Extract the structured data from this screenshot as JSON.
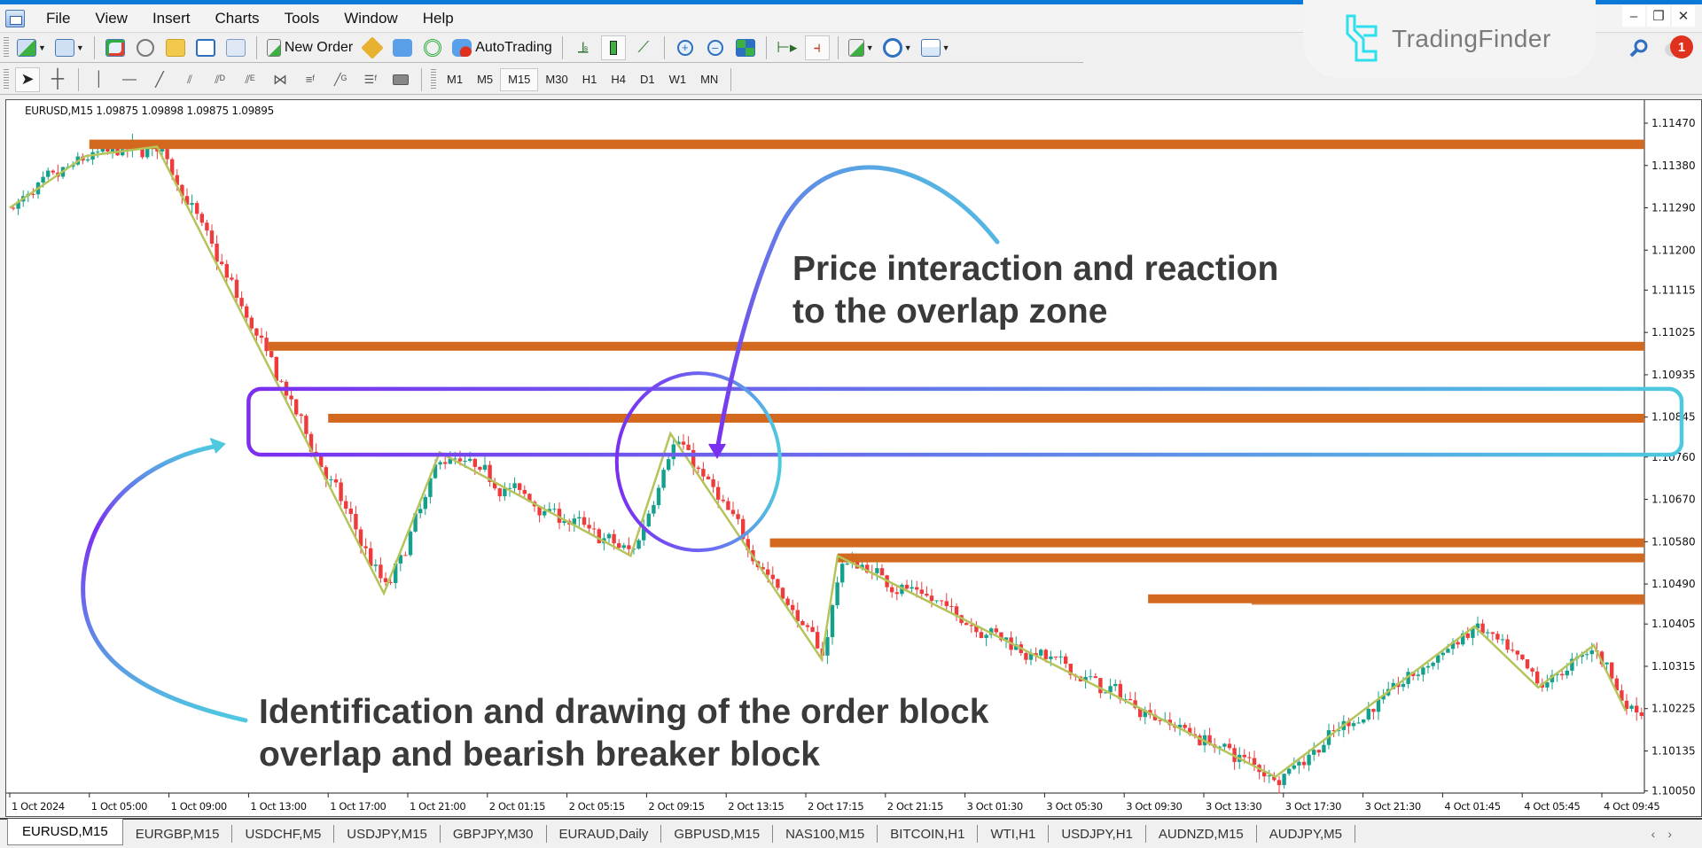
{
  "menu": [
    "File",
    "View",
    "Insert",
    "Charts",
    "Tools",
    "Window",
    "Help"
  ],
  "window_controls": {
    "minimize": "–",
    "restore": "❐",
    "close": "✕"
  },
  "toolbar1": {
    "new_order_label": "New Order",
    "autotrading_label": "AutoTrading",
    "icons": [
      "new-chart-icon",
      "profiles-icon",
      "market-watch-icon",
      "data-window-icon",
      "navigator-icon",
      "terminal-icon",
      "strategy-tester-icon",
      "new-order-icon",
      "metaeditor-icon",
      "signals-icon",
      "autotrading-icon",
      "bar-chart-icon",
      "candlestick-icon",
      "line-chart-icon",
      "zoom-in-icon",
      "zoom-out-icon",
      "tile-windows-icon",
      "autoscroll-icon",
      "chart-shift-icon",
      "indicators-icon",
      "periods-icon",
      "templates-icon"
    ]
  },
  "toolbar2": {
    "tools": [
      "cursor-icon",
      "crosshair-icon",
      "vertical-line-icon",
      "horizontal-line-icon",
      "trendline-icon",
      "equidistant-channel-icon",
      "std-deviation-channel-icon",
      "regression-channel-icon",
      "gann-grid-icon",
      "fibonacci-retracement-icon",
      "gann-line-icon",
      "fibonacci-expansion-icon",
      "rectangle-icon"
    ],
    "timeframes": [
      "M1",
      "M5",
      "M15",
      "M30",
      "H1",
      "H4",
      "D1",
      "W1",
      "MN"
    ],
    "active_timeframe": "M15"
  },
  "branding": {
    "logo_text": "TradingFinder",
    "accent": "#2ee0ee"
  },
  "notifications": {
    "count": "1"
  },
  "chart": {
    "symbol_info": "EURUSD,M15  1.09875 1.09898 1.09875 1.09895",
    "symbol": "EURUSD",
    "timeframe": "M15",
    "ohlc": {
      "open": "1.09875",
      "high": "1.09898",
      "low": "1.09875",
      "close": "1.09895"
    },
    "colors": {
      "bull": "#14a08c",
      "bear": "#ee3b3b",
      "zone": "#d2691e",
      "zigzag": "#b5c45a",
      "overlap_start": "#7b2ff0",
      "overlap_end": "#4ec9e0"
    }
  },
  "chart_data": {
    "type": "candlestick",
    "title": "EURUSD,M15",
    "price_ticks": [
      "1.11470",
      "1.11380",
      "1.11290",
      "1.11200",
      "1.11115",
      "1.11025",
      "1.10935",
      "1.10845",
      "1.10760",
      "1.10670",
      "1.10580",
      "1.10490",
      "1.10405",
      "1.10315",
      "1.10225",
      "1.10135",
      "1.10050"
    ],
    "ylim": [
      1.1005,
      1.1147
    ],
    "time_ticks": [
      "1 Oct 2024",
      "1 Oct 05:00",
      "1 Oct 09:00",
      "1 Oct 13:00",
      "1 Oct 17:00",
      "1 Oct 21:00",
      "2 Oct 01:15",
      "2 Oct 05:15",
      "2 Oct 09:15",
      "2 Oct 13:15",
      "2 Oct 17:15",
      "2 Oct 21:15",
      "3 Oct 01:30",
      "3 Oct 05:30",
      "3 Oct 09:30",
      "3 Oct 13:30",
      "3 Oct 17:30",
      "3 Oct 21:30",
      "4 Oct 01:45",
      "4 Oct 05:45",
      "4 Oct 09:45"
    ],
    "zigzag": [
      {
        "t": 0.0,
        "p": 1.1129
      },
      {
        "t": 0.95,
        "p": 1.114
      },
      {
        "t": 1.85,
        "p": 1.1142
      },
      {
        "t": 4.7,
        "p": 1.1047
      },
      {
        "t": 5.4,
        "p": 1.1077
      },
      {
        "t": 7.8,
        "p": 1.1055
      },
      {
        "t": 8.3,
        "p": 1.1081
      },
      {
        "t": 10.2,
        "p": 1.1033
      },
      {
        "t": 10.4,
        "p": 1.1055
      },
      {
        "t": 13.8,
        "p": 1.1026
      },
      {
        "t": 15.9,
        "p": 1.1008
      },
      {
        "t": 18.4,
        "p": 1.104
      },
      {
        "t": 19.2,
        "p": 1.1027
      },
      {
        "t": 19.9,
        "p": 1.1036
      },
      {
        "t": 20.3,
        "p": 1.1022
      }
    ],
    "zones": [
      {
        "name": "order-block-1",
        "from_t": 1.0,
        "top": 1.11435,
        "bottom": 1.11415
      },
      {
        "name": "order-block-2",
        "from_t": 3.25,
        "top": 1.11005,
        "bottom": 1.10992
      },
      {
        "name": "order-block-3",
        "from_t": 4.0,
        "top": 1.10852,
        "bottom": 1.10838
      },
      {
        "name": "order-block-4",
        "from_t": 9.55,
        "top": 1.10587,
        "bottom": 1.10572
      },
      {
        "name": "order-block-5",
        "from_t": 10.4,
        "top": 1.10555,
        "bottom": 1.10538
      },
      {
        "name": "order-block-6",
        "from_t": 14.3,
        "top": 1.10468,
        "bottom": 1.10458
      },
      {
        "name": "breaker-block-line",
        "from_t": 15.6,
        "top": 1.1045,
        "bottom": 1.10446
      }
    ],
    "overlap_zone": {
      "top": 1.10905,
      "bottom": 1.10765,
      "from_t": 3.0
    },
    "highlight_circle": {
      "t": 8.65,
      "p": 1.1075
    }
  },
  "annotations": {
    "top": [
      "Price interaction and reaction",
      "to the overlap zone"
    ],
    "bottom": [
      "Identification and drawing of the order block",
      "overlap and bearish breaker block"
    ]
  },
  "tabs": [
    "EURUSD,M15",
    "EURGBP,M15",
    "USDCHF,M5",
    "USDJPY,M15",
    "GBPJPY,M30",
    "EURAUD,Daily",
    "GBPUSD,M15",
    "NAS100,M15",
    "BITCOIN,H1",
    "WTI,H1",
    "USDJPY,H1",
    "AUDNZD,M15",
    "AUDJPY,M5"
  ],
  "tab_nav": {
    "left": "‹",
    "right": "›"
  }
}
